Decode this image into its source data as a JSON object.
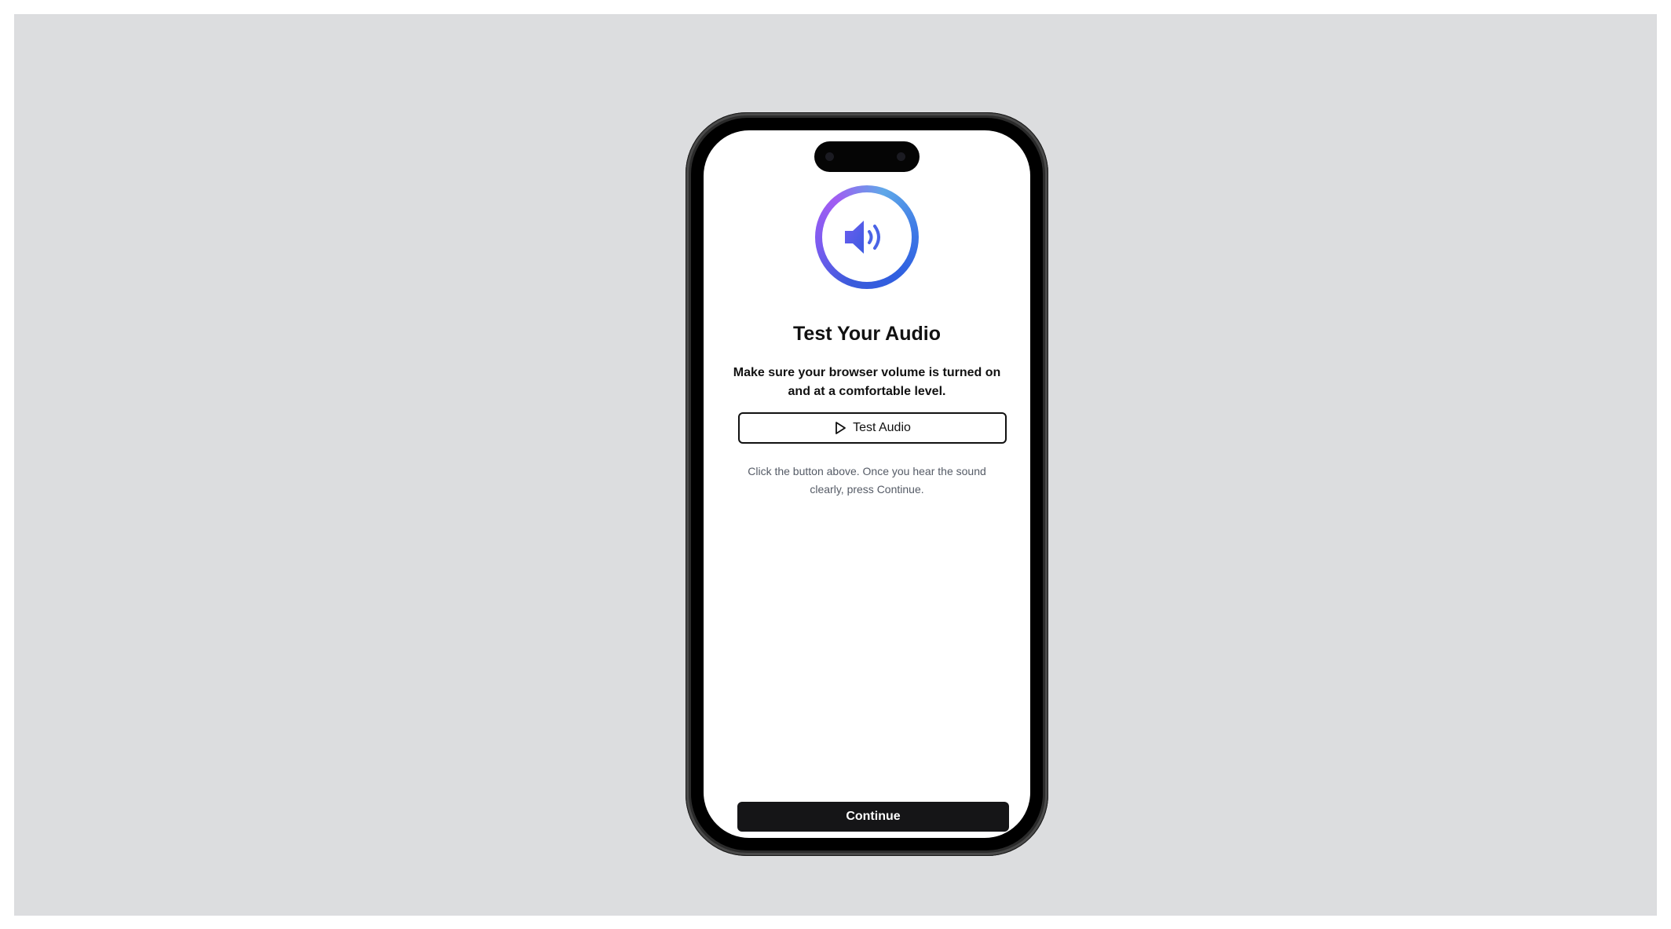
{
  "screen": {
    "title": "Test Your Audio",
    "description": "Make sure your browser volume is turned on and at a comfortable level.",
    "test_button": {
      "label": "Test Audio",
      "icon": "play-icon"
    },
    "hint": "Click the button above. Once you hear the sound clearly, press Continue.",
    "continue_button": {
      "label": "Continue"
    },
    "hero_icon": "speaker-icon"
  },
  "colors": {
    "background": "#dcdddf",
    "primary_button": "#151517",
    "ring_gradient_start": "#a25cf2",
    "ring_gradient_end": "#2f5fe0",
    "speaker": "#4a63e6",
    "hint_text": "#555b66"
  }
}
